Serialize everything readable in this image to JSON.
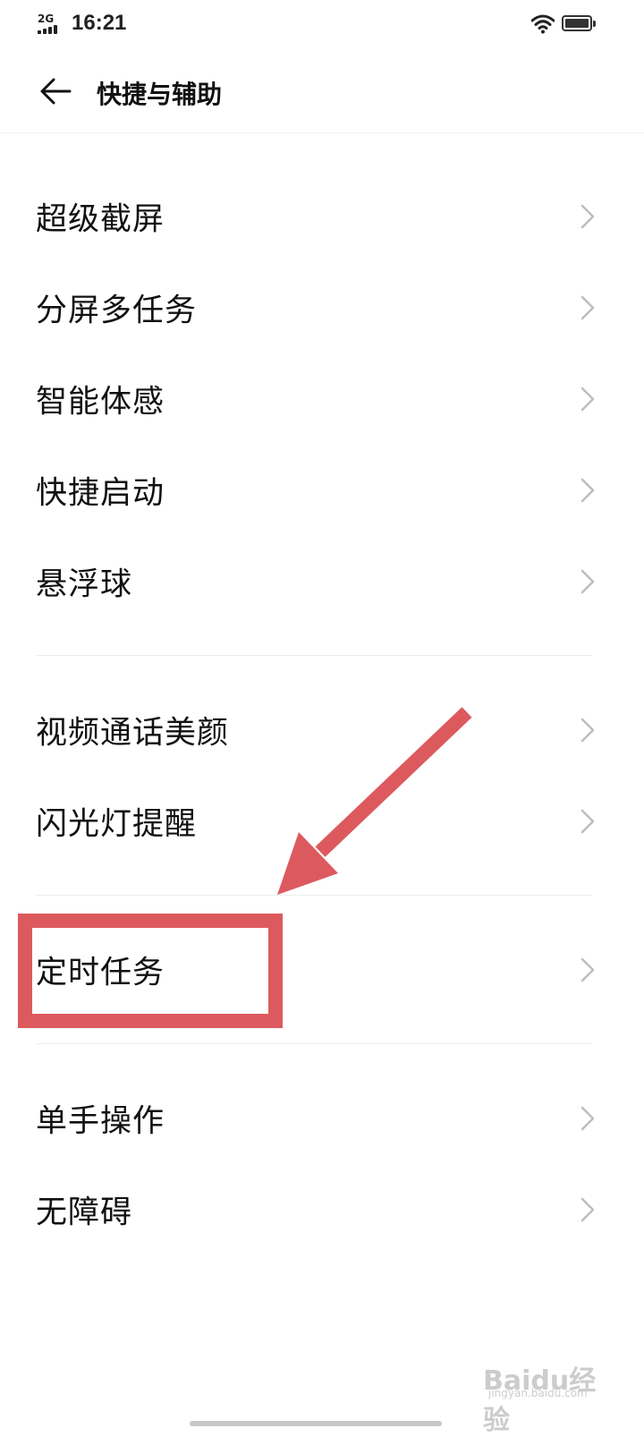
{
  "status_bar": {
    "network": "2G",
    "time": "16:21",
    "wifi_icon": "wifi-icon",
    "battery_icon": "battery-icon"
  },
  "header": {
    "back_icon": "arrow-left-icon",
    "title": "快捷与辅助"
  },
  "groups": [
    {
      "items": [
        {
          "label": "超级截屏",
          "icon": "chevron-right-icon"
        },
        {
          "label": "分屏多任务",
          "icon": "chevron-right-icon"
        },
        {
          "label": "智能体感",
          "icon": "chevron-right-icon"
        },
        {
          "label": "快捷启动",
          "icon": "chevron-right-icon"
        },
        {
          "label": "悬浮球",
          "icon": "chevron-right-icon"
        }
      ]
    },
    {
      "items": [
        {
          "label": "视频通话美颜",
          "icon": "chevron-right-icon"
        },
        {
          "label": "闪光灯提醒",
          "icon": "chevron-right-icon"
        }
      ]
    },
    {
      "items": [
        {
          "label": "定时任务",
          "icon": "chevron-right-icon"
        }
      ]
    },
    {
      "items": [
        {
          "label": "单手操作",
          "icon": "chevron-right-icon"
        },
        {
          "label": "无障碍",
          "icon": "chevron-right-icon"
        }
      ]
    }
  ],
  "annotation": {
    "highlight_color": "#dc5a5e",
    "arrow_color": "#dc5a5e"
  },
  "watermark": {
    "text": "Baidu经验",
    "subtext": "jingyan.baidu.com"
  }
}
